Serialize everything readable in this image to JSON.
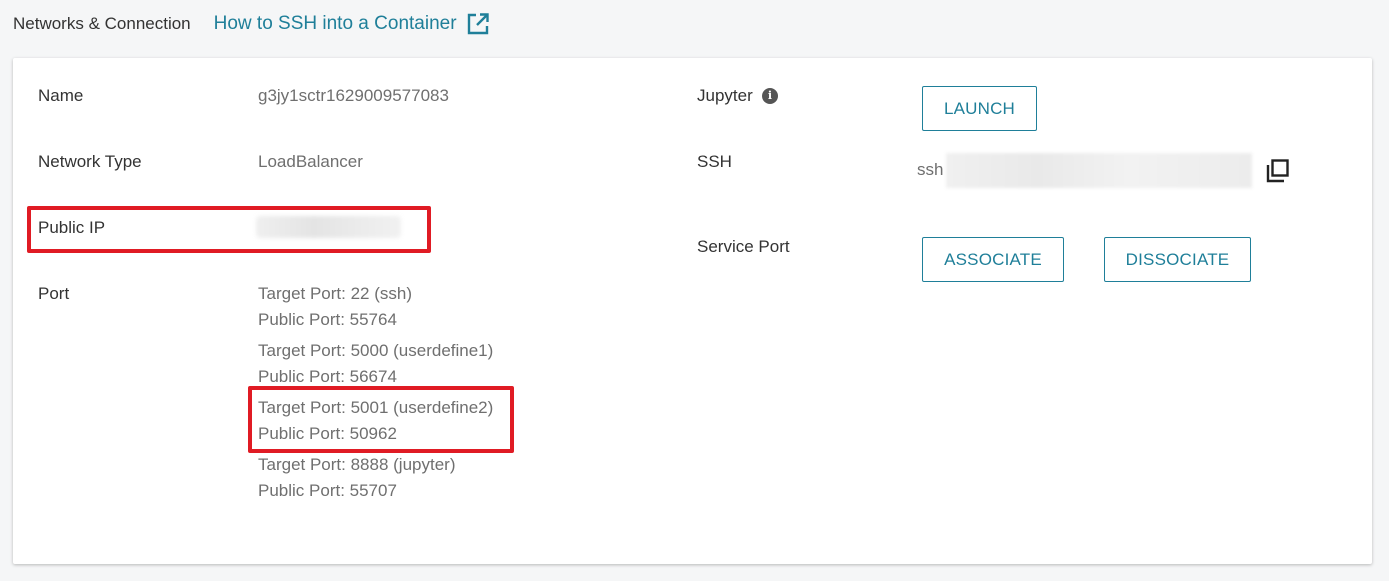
{
  "header": {
    "section_title": "Networks & Connection",
    "doc_link": "How to SSH into a Container",
    "doc_link_icon": "external-link-icon"
  },
  "details": {
    "name_label": "Name",
    "name_value": "g3jy1sctr1629009577083",
    "network_type_label": "Network Type",
    "network_type_value": "LoadBalancer",
    "public_ip_label": "Public IP",
    "port_label": "Port",
    "ports": [
      {
        "target": "Target Port: 22 (ssh)",
        "public": "Public Port: 55764"
      },
      {
        "target": "Target Port: 5000 (userdefine1)",
        "public": "Public Port: 56674"
      },
      {
        "target": "Target Port: 5001 (userdefine2)",
        "public": "Public Port: 50962"
      },
      {
        "target": "Target Port: 8888 (jupyter)",
        "public": "Public Port: 55707"
      }
    ]
  },
  "access": {
    "jupyter_label": "Jupyter",
    "jupyter_info_icon": "info-icon",
    "launch_button": "LAUNCH",
    "ssh_label": "SSH",
    "ssh_prefix": "ssh",
    "ssh_copy_icon": "copy-icon",
    "service_port_label": "Service Port",
    "associate_button": "ASSOCIATE",
    "dissociate_button": "DISSOCIATE"
  },
  "colors": {
    "accent": "#1f7f99",
    "highlight": "#e01b24",
    "label": "#333333",
    "value": "#6f6f6f"
  }
}
